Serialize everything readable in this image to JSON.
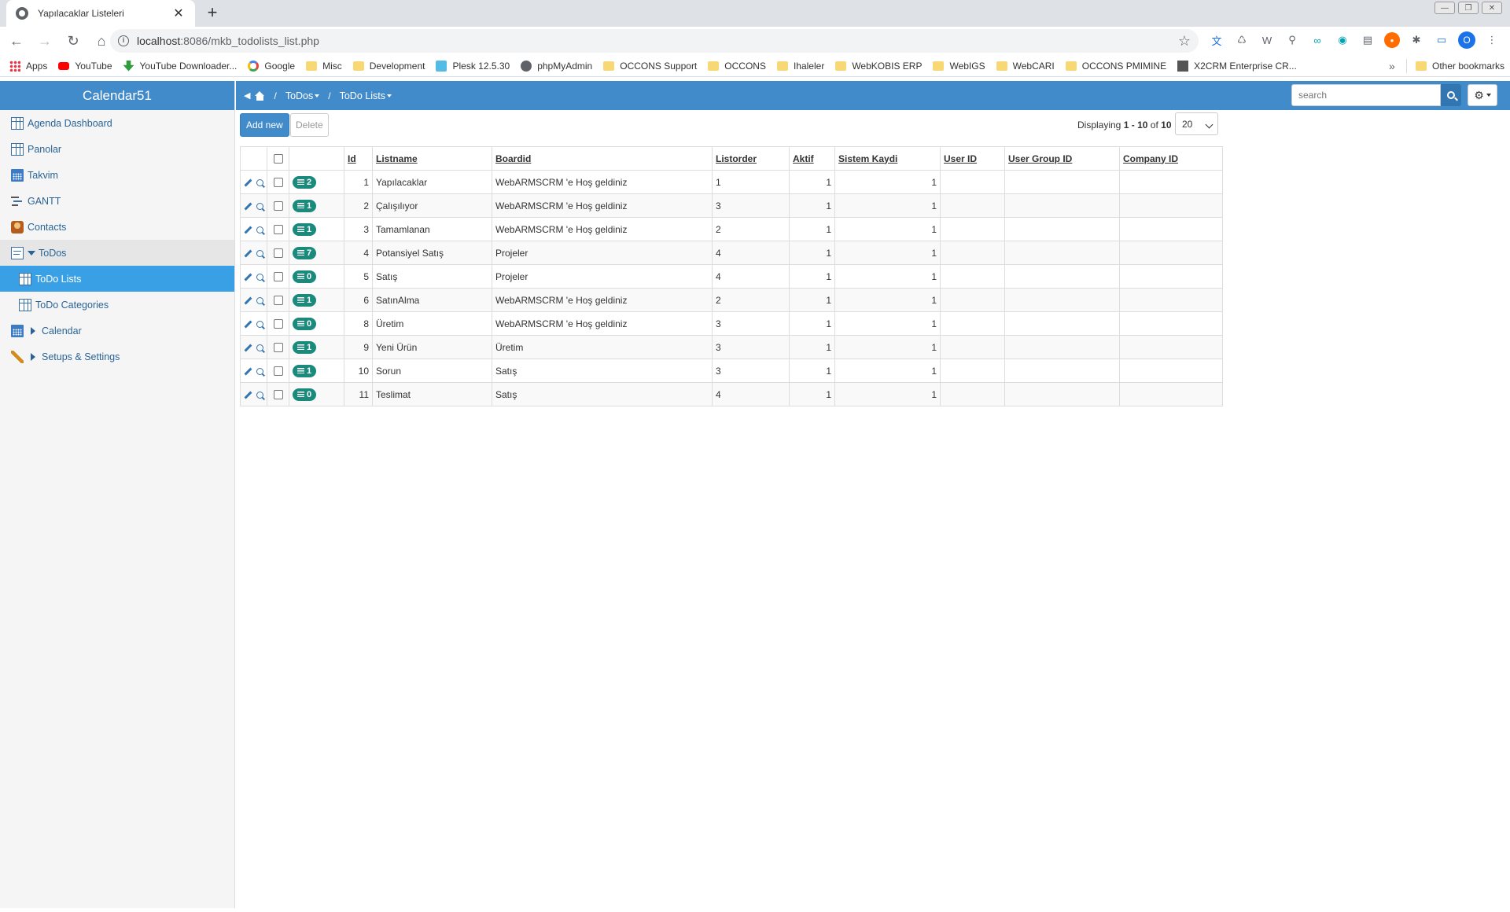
{
  "browser": {
    "tab_title": "Yapılacaklar Listeleri",
    "url_host": "localhost",
    "url_rest": ":8086/mkb_todolists_list.php",
    "bookmarks": [
      {
        "label": "Apps",
        "icon": "apps"
      },
      {
        "label": "YouTube",
        "icon": "yt"
      },
      {
        "label": "YouTube Downloader...",
        "icon": "dl"
      },
      {
        "label": "Google",
        "icon": "g"
      },
      {
        "label": "Misc",
        "icon": "folder"
      },
      {
        "label": "Development",
        "icon": "folder"
      },
      {
        "label": "Plesk 12.5.30",
        "icon": "plesk"
      },
      {
        "label": "phpMyAdmin",
        "icon": "globe"
      },
      {
        "label": "OCCONS Support",
        "icon": "folder"
      },
      {
        "label": "OCCONS",
        "icon": "folder"
      },
      {
        "label": "Ihaleler",
        "icon": "folder"
      },
      {
        "label": "WebKOBIS ERP",
        "icon": "folder"
      },
      {
        "label": "WebIGS",
        "icon": "folder"
      },
      {
        "label": "WebCARI",
        "icon": "folder"
      },
      {
        "label": "OCCONS PMIMINE",
        "icon": "folder"
      },
      {
        "label": "X2CRM Enterprise CR...",
        "icon": "x2"
      }
    ],
    "other_bookmarks": "Other bookmarks",
    "profile_initial": "O"
  },
  "sidebar": {
    "brand": "Calendar51",
    "items": [
      {
        "label": "Agenda Dashboard",
        "icon": "grid-icon"
      },
      {
        "label": "Panolar",
        "icon": "grid-icon"
      },
      {
        "label": "Takvim",
        "icon": "calendar-icon"
      },
      {
        "label": "GANTT",
        "icon": "gantt-icon"
      },
      {
        "label": "Contacts",
        "icon": "contacts-icon"
      },
      {
        "label": "ToDos",
        "icon": "todo-icon"
      },
      {
        "label": "ToDo Lists",
        "icon": "grid-icon"
      },
      {
        "label": "ToDo Categories",
        "icon": "grid-icon"
      },
      {
        "label": "Calendar",
        "icon": "calendar-icon"
      },
      {
        "label": "Setups & Settings",
        "icon": "wrench-icon"
      }
    ]
  },
  "breadcrumb": {
    "sep": "/",
    "level1": "ToDos",
    "level2": "ToDo Lists"
  },
  "search": {
    "placeholder": "search"
  },
  "actions": {
    "add_new": "Add new",
    "delete": "Delete"
  },
  "pagination": {
    "prefix": "Displaying",
    "from": "1",
    "dash": "-",
    "to": "10",
    "of": "of",
    "total": "10",
    "page_size": "20"
  },
  "table": {
    "columns": [
      "Id",
      "Listname",
      "Boardid",
      "Listorder",
      "Aktif",
      "Sistem Kaydi",
      "User ID",
      "User Group ID",
      "Company ID"
    ],
    "rows": [
      {
        "badge": "2",
        "id": "1",
        "listname": "Yapılacaklar",
        "boardid": "WebARMSCRM 'e Hoş geldiniz",
        "listorder": "1",
        "aktif": "1",
        "sistem": "1"
      },
      {
        "badge": "1",
        "id": "2",
        "listname": "Çalışılıyor",
        "boardid": "WebARMSCRM 'e Hoş geldiniz",
        "listorder": "3",
        "aktif": "1",
        "sistem": "1"
      },
      {
        "badge": "1",
        "id": "3",
        "listname": "Tamamlanan",
        "boardid": "WebARMSCRM 'e Hoş geldiniz",
        "listorder": "2",
        "aktif": "1",
        "sistem": "1"
      },
      {
        "badge": "7",
        "id": "4",
        "listname": "Potansiyel Satış",
        "boardid": "Projeler",
        "listorder": "4",
        "aktif": "1",
        "sistem": "1"
      },
      {
        "badge": "0",
        "id": "5",
        "listname": "Satış",
        "boardid": "Projeler",
        "listorder": "4",
        "aktif": "1",
        "sistem": "1"
      },
      {
        "badge": "1",
        "id": "6",
        "listname": "SatınAlma",
        "boardid": "WebARMSCRM 'e Hoş geldiniz",
        "listorder": "2",
        "aktif": "1",
        "sistem": "1"
      },
      {
        "badge": "0",
        "id": "8",
        "listname": "Üretim",
        "boardid": "WebARMSCRM 'e Hoş geldiniz",
        "listorder": "3",
        "aktif": "1",
        "sistem": "1"
      },
      {
        "badge": "1",
        "id": "9",
        "listname": "Yeni Ürün",
        "boardid": "Üretim",
        "listorder": "3",
        "aktif": "1",
        "sistem": "1"
      },
      {
        "badge": "1",
        "id": "10",
        "listname": "Sorun",
        "boardid": "Satış",
        "listorder": "3",
        "aktif": "1",
        "sistem": "1"
      },
      {
        "badge": "0",
        "id": "11",
        "listname": "Teslimat",
        "boardid": "Satış",
        "listorder": "4",
        "aktif": "1",
        "sistem": "1"
      }
    ]
  },
  "colors": {
    "accent": "#428bca",
    "selected": "#3aa0e6",
    "badge": "#1a8a7d"
  }
}
